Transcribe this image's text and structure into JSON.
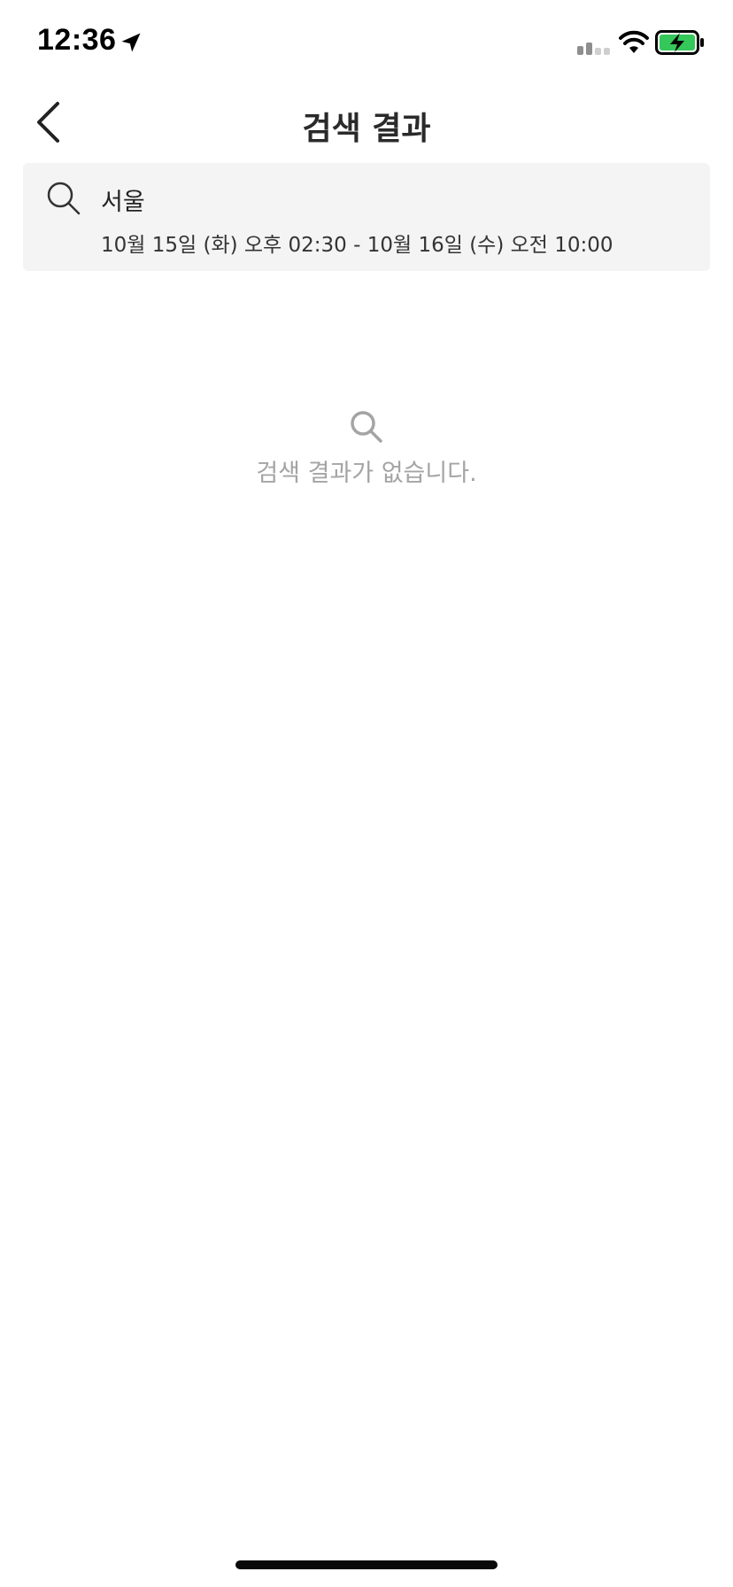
{
  "status_bar": {
    "time": "12:36",
    "location_icon": "location-arrow-icon",
    "signal_icon": "cellular-signal-icon",
    "wifi_icon": "wifi-icon",
    "battery_icon": "battery-charging-icon",
    "battery_color": "#34c759"
  },
  "header": {
    "back_icon": "chevron-left-icon",
    "title": "검색 결과"
  },
  "search_summary": {
    "icon": "search-icon",
    "location": "서울",
    "dates": "10월 15일 (화) 오후 02:30 - 10월 16일 (수) 오전 10:00"
  },
  "empty_state": {
    "icon": "search-icon",
    "message": "검색 결과가 없습니다."
  },
  "colors": {
    "background": "#ffffff",
    "card_background": "#f4f4f4",
    "empty_text": "#a4a4a4",
    "title_text": "#2a2a2a"
  }
}
